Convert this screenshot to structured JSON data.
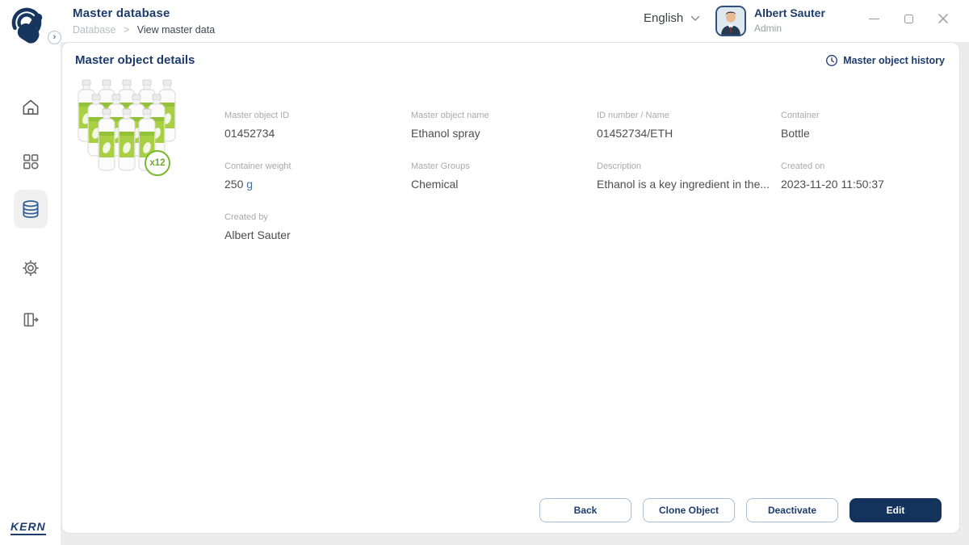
{
  "header": {
    "title": "Master database",
    "breadcrumb": {
      "parent": "Database",
      "separator": ">",
      "current": "View master data"
    },
    "language_selector": {
      "value": "English"
    },
    "user": {
      "name": "Albert Sauter",
      "role": "Admin"
    }
  },
  "sidebar": {
    "items": [
      {
        "id": "home",
        "icon": "home-icon",
        "active": false
      },
      {
        "id": "apps",
        "icon": "apps-grid-icon",
        "active": false
      },
      {
        "id": "database",
        "icon": "database-icon",
        "active": true
      },
      {
        "id": "settings",
        "icon": "gear-icon",
        "active": false
      },
      {
        "id": "logout",
        "icon": "logout-icon",
        "active": false
      }
    ],
    "brand": "KERN"
  },
  "card": {
    "title": "Master object details",
    "history_link": "Master object history",
    "product": {
      "badge": "x12"
    },
    "fields": [
      {
        "label": "Master object ID",
        "value": "01452734"
      },
      {
        "label": "Master object name",
        "value": "Ethanol spray"
      },
      {
        "label": "ID number / Name",
        "value": "01452734/ETH"
      },
      {
        "label": "Container",
        "value": "Bottle"
      },
      {
        "label": "Container weight",
        "value": "250",
        "unit": "g"
      },
      {
        "label": "Master Groups",
        "value": "Chemical"
      },
      {
        "label": "Description",
        "value": "Ethanol is a key ingredient in the..."
      },
      {
        "label": "Created on",
        "value": "2023-11-20 11:50:37"
      },
      {
        "label": "Created by",
        "value": "Albert Sauter"
      }
    ]
  },
  "footer": {
    "buttons": [
      {
        "label": "Back"
      },
      {
        "label": "Clone Object"
      },
      {
        "label": "Deactivate"
      },
      {
        "label": "Edit",
        "primary": true
      }
    ]
  },
  "colors": {
    "brand_navy": "#1d3c6e",
    "primary_button": "#14335c",
    "button_border": "#a9bcd8",
    "unit_link_blue": "#3a6fb0",
    "label_gray": "#a9a9a9",
    "active_item_bg": "#f0f0f0",
    "badge_green": "#7ab82e"
  }
}
